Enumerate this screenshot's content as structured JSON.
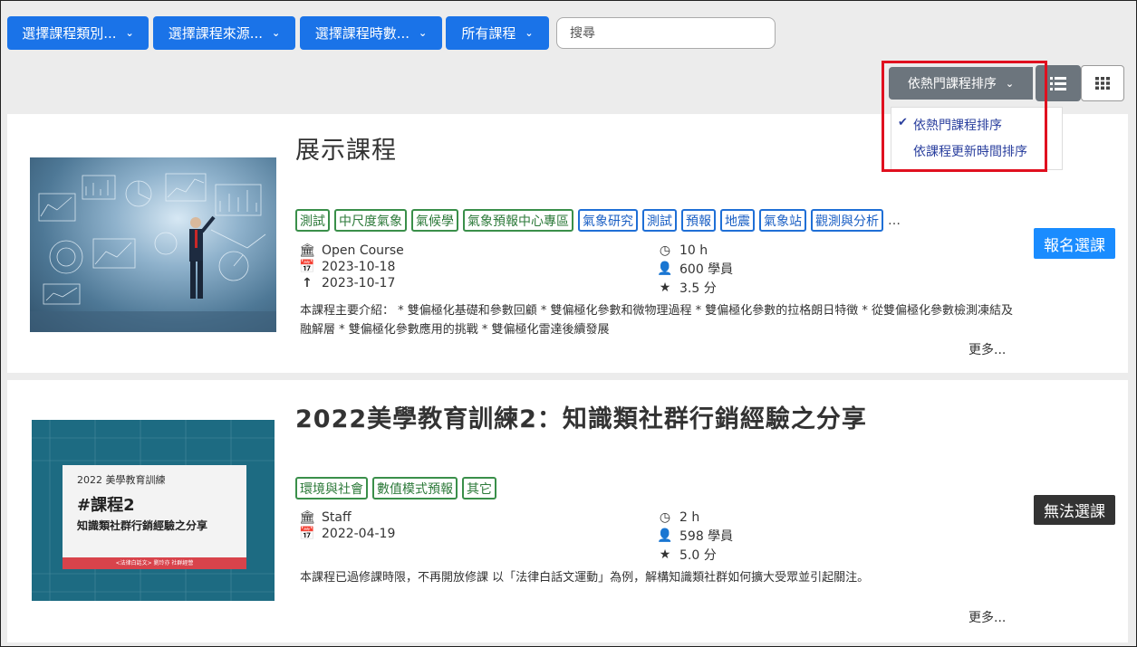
{
  "filters": {
    "category": "選擇課程類別...",
    "source": "選擇課程來源...",
    "hours": "選擇課程時數...",
    "all": "所有課程",
    "search_placeholder": "搜尋"
  },
  "sort": {
    "current": "依熱門課程排序",
    "options": [
      "依熱門課程排序",
      "依課程更新時間排序"
    ],
    "selected_index": 0
  },
  "courses": [
    {
      "title": "展示課程",
      "tags": [
        {
          "label": "測試",
          "color": "green"
        },
        {
          "label": "中尺度氣象",
          "color": "green"
        },
        {
          "label": "氣候學",
          "color": "green"
        },
        {
          "label": "氣象預報中心專區",
          "color": "green"
        },
        {
          "label": "氣象研究",
          "color": "blue"
        },
        {
          "label": "測試",
          "color": "blue"
        },
        {
          "label": "預報",
          "color": "blue"
        },
        {
          "label": "地震",
          "color": "blue"
        },
        {
          "label": "氣象站",
          "color": "blue"
        },
        {
          "label": "觀測與分析",
          "color": "blue"
        }
      ],
      "more_tags": "…",
      "source": "Open Course",
      "date1": "2023-10-18",
      "date2": "2023-10-17",
      "hours": "10 h",
      "students": "600 學員",
      "rating": "3.5 分",
      "description": "本課程主要介紹： * 雙偏極化基礎和參數回顧 * 雙偏極化參數和微物理過程 * 雙偏極化參數的拉格朗日特徵 * 從雙偏極化參數檢測凍結及融解層 * 雙偏極化參數應用的挑戰 * 雙偏極化雷達後續發展",
      "more": "更多...",
      "action": "報名選課"
    },
    {
      "title": "2022美學教育訓練2：知識類社群行銷經驗之分享",
      "thumb_line1": "2022 美學教育訓練",
      "thumb_line2": "#課程2",
      "thumb_line3": "知識類社群行銷經驗之分享",
      "thumb_footer": "<法律白話文> 劉玲亦 社群經營",
      "tags": [
        {
          "label": "環境與社會",
          "color": "green"
        },
        {
          "label": "數值模式預報",
          "color": "green"
        },
        {
          "label": "其它",
          "color": "green"
        }
      ],
      "source": "Staff",
      "date1": "2022-04-19",
      "hours": "2 h",
      "students": "598 學員",
      "rating": "5.0 分",
      "description": "本課程已過修課時限，不再開放修課 以「法律白話文運動」為例，解構知識類社群如何擴大受眾並引起關注。",
      "more": "更多...",
      "action": "無法選課"
    }
  ],
  "colors": {
    "primary": "#1a73e8",
    "secondary": "#6c757d",
    "enroll": "#1a8cff",
    "disabled": "#333333",
    "highlight": "#e0101f"
  }
}
